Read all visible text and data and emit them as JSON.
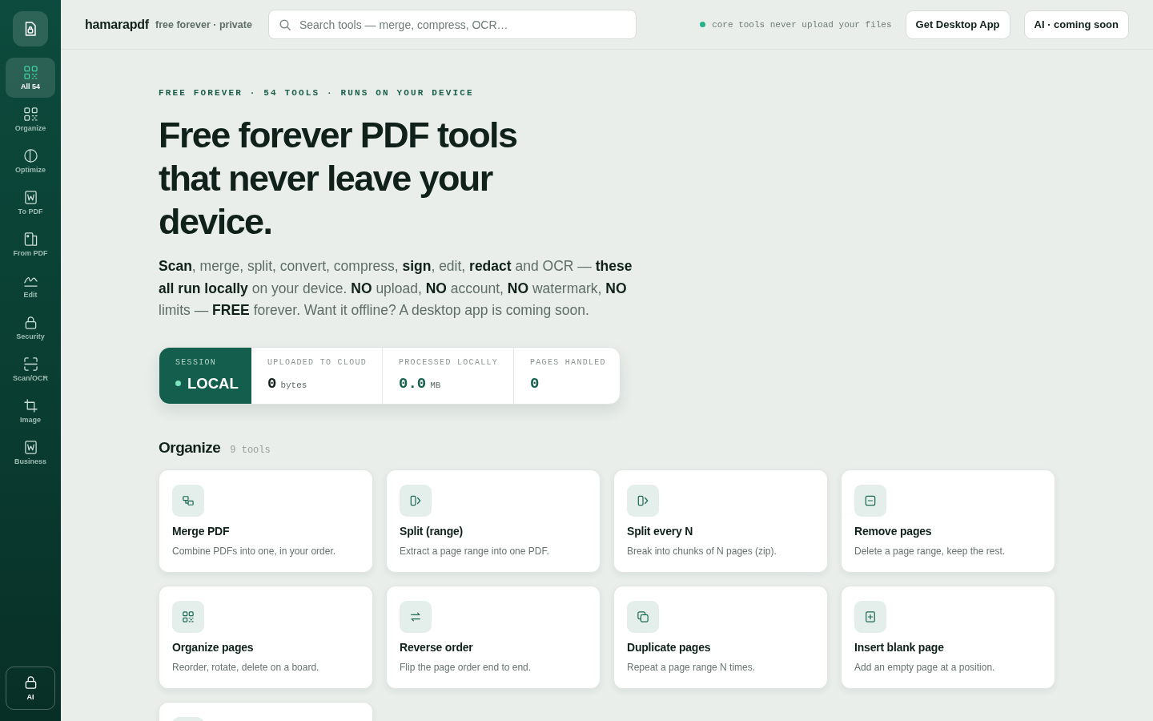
{
  "sidebar": {
    "items": [
      {
        "label": "All 54",
        "kind": "all",
        "selected": true
      },
      {
        "label": "Organize",
        "kind": "organize",
        "selected": false
      },
      {
        "label": "Optimize",
        "kind": "optimize",
        "selected": false
      },
      {
        "label": "To PDF",
        "kind": "topdf",
        "selected": false
      },
      {
        "label": "From PDF",
        "kind": "frompdf",
        "selected": false
      },
      {
        "label": "Edit",
        "kind": "edit",
        "selected": false
      },
      {
        "label": "Security",
        "kind": "security",
        "selected": false
      },
      {
        "label": "Scan/OCR",
        "kind": "scan",
        "selected": false
      },
      {
        "label": "Image",
        "kind": "image",
        "selected": false
      },
      {
        "label": "Business",
        "kind": "business",
        "selected": false
      }
    ],
    "footer_button": {
      "label": "AI"
    }
  },
  "topbar": {
    "brand": "hamarapdf",
    "tagline": "free forever · private",
    "search": {
      "placeholder": "Search tools — merge, compress, OCR…"
    },
    "status": "core tools never upload your files",
    "buttons": [
      "Get Desktop App",
      "AI · coming soon"
    ]
  },
  "hero": {
    "eyebrow": "FREE FOREVER · 54 TOOLS · RUNS ON YOUR DEVICE",
    "title": "Free forever PDF tools that never leave your device.",
    "intro": "**Scan**, merge, split, convert, compress, **sign**, edit, **redact** and OCR — **these all run locally** on your device. **NO** upload, **NO** account, **NO** watermark, **NO** limits — **FREE** forever. Want it offline? A desktop app is coming soon."
  },
  "stats": [
    {
      "kind": "session",
      "label": "SESSION",
      "value": "LOCAL"
    },
    {
      "kind": "plain",
      "label": "UPLOADED TO CLOUD",
      "value": "0",
      "unit": "bytes"
    },
    {
      "kind": "accent",
      "label": "PROCESSED LOCALLY",
      "value": "0.0",
      "unit": "MB"
    },
    {
      "kind": "accent",
      "label": "PAGES HANDLED",
      "value": "0"
    }
  ],
  "section": {
    "title": "Organize",
    "count": "9 tools",
    "tools": [
      {
        "kind": "merge",
        "title": "Merge PDF",
        "description": "Combine PDFs into one, in your order."
      },
      {
        "kind": "split",
        "title": "Split (range)",
        "description": "Extract a page range into one PDF."
      },
      {
        "kind": "split",
        "title": "Split every N",
        "description": "Break into chunks of N pages (zip)."
      },
      {
        "kind": "remove",
        "title": "Remove pages",
        "description": "Delete a page range, keep the rest."
      },
      {
        "kind": "organize",
        "title": "Organize pages",
        "description": "Reorder, rotate, delete on a board."
      },
      {
        "kind": "reverse",
        "title": "Reverse order",
        "description": "Flip the page order end to end."
      },
      {
        "kind": "duplicate",
        "title": "Duplicate pages",
        "description": "Repeat a page range N times."
      },
      {
        "kind": "insert",
        "title": "Insert blank page",
        "description": "Add an empty page at a position."
      },
      {
        "kind": "hidden"
      }
    ]
  }
}
